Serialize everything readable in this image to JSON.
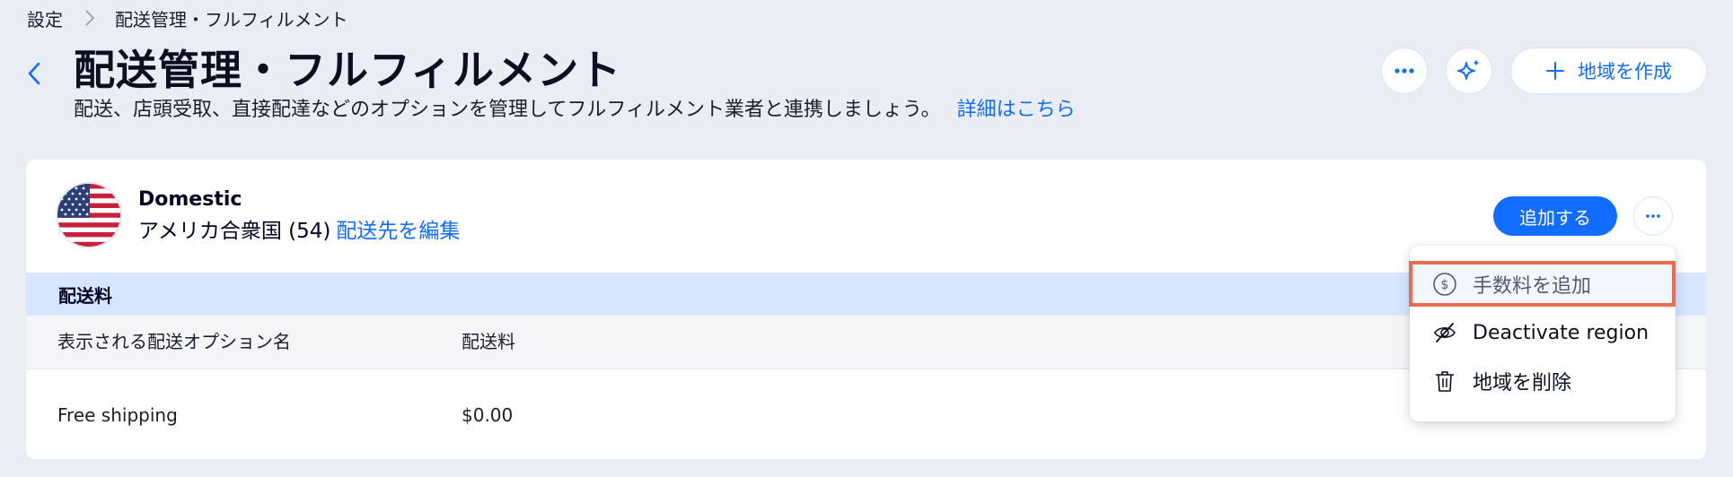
{
  "breadcrumb": {
    "root": "設定",
    "current": "配送管理・フルフィルメント"
  },
  "header": {
    "title": "配送管理・フルフィルメント",
    "subtitle": "配送、店頭受取、直接配達などのオプションを管理してフルフィルメント業者と連携しましょう。",
    "learn_more": "詳細はこちら",
    "create_region_label": "地域を作成"
  },
  "region": {
    "name": "Domestic",
    "destinations": "アメリカ合衆国 (54)",
    "edit_destinations": "配送先を編集",
    "add_button": "追加する",
    "flag_icon": "us-flag-icon"
  },
  "table": {
    "section_title": "配送料",
    "columns": [
      "表示される配送オプション名",
      "配送料"
    ],
    "rows": [
      {
        "name": "Free shipping",
        "rate": "$0.00"
      }
    ]
  },
  "menu": {
    "items": [
      {
        "label": "手数料を追加",
        "icon": "dollar-circle-icon",
        "highlighted": true
      },
      {
        "label": "Deactivate region",
        "icon": "eye-off-icon"
      },
      {
        "label": "地域を削除",
        "icon": "trash-icon"
      }
    ]
  },
  "colors": {
    "accent": "#116dff",
    "background": "#eaedf3",
    "section_header": "#d6e6fe",
    "highlight_border": "#e86c4f"
  }
}
